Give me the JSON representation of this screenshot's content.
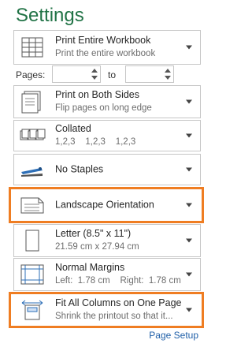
{
  "title": "Settings",
  "print_what": {
    "main": "Print Entire Workbook",
    "sub": "Print the entire workbook"
  },
  "pages": {
    "label": "Pages:",
    "to_label": "to",
    "from_value": "",
    "to_value": ""
  },
  "sides": {
    "main": "Print on Both Sides",
    "sub": "Flip pages on long edge"
  },
  "collation": {
    "main": "Collated",
    "sub": "1,2,3    1,2,3    1,2,3"
  },
  "staples": {
    "main": "No Staples"
  },
  "orientation": {
    "main": "Landscape Orientation"
  },
  "paper": {
    "main": "Letter (8.5\" x 11\")",
    "sub": "21.59 cm x 27.94 cm"
  },
  "margins": {
    "main": "Normal Margins",
    "sub": "Left:  1.78 cm    Right:  1.78 cm"
  },
  "scaling": {
    "main": "Fit All Columns on One Page",
    "sub": "Shrink the printout so that it..."
  },
  "page_setup_link": "Page Setup",
  "colors": {
    "accent": "#217346",
    "highlight": "#ef7d22",
    "link": "#1f5fa8"
  }
}
